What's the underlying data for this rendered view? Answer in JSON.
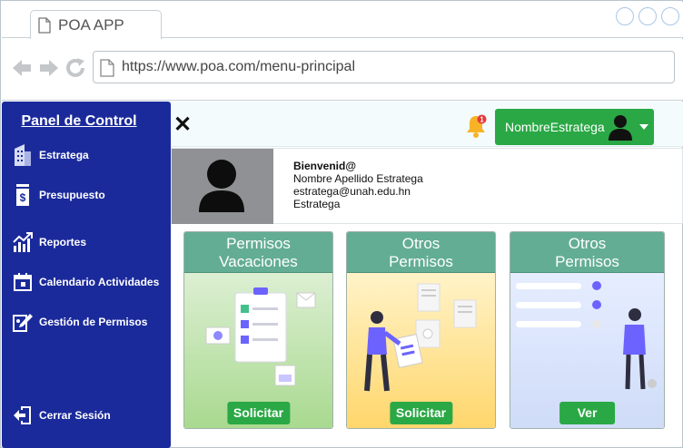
{
  "browser": {
    "tab_title": "POA APP",
    "url": "https://www.poa.com/menu-principal"
  },
  "sidebar": {
    "title": "Panel de Control",
    "items": [
      {
        "label": "Estratega",
        "icon": "building-icon"
      },
      {
        "label": "Presupuesto",
        "icon": "budget-icon"
      },
      {
        "label": "Reportes",
        "icon": "chart-icon"
      },
      {
        "label": "Calendario Actividades",
        "icon": "calendar-icon"
      },
      {
        "label": "Gestión de Permisos",
        "icon": "permissions-icon"
      }
    ],
    "logout": {
      "label": "Cerrar Sesión",
      "icon": "logout-icon"
    }
  },
  "topbar": {
    "user_name": "NombreEstratega",
    "notification_count": "1"
  },
  "profile": {
    "greeting": "Bienvenid@",
    "full_name": "Nombre Apellido Estratega",
    "email": "estratega@unah.edu.hn",
    "role": "Estratega"
  },
  "cards": [
    {
      "title_line1": "Permisos",
      "title_line2": "Vacaciones",
      "button": "Solicitar"
    },
    {
      "title_line1": "Otros",
      "title_line2": "Permisos",
      "button": "Solicitar"
    },
    {
      "title_line1": "Otros",
      "title_line2": "Permisos",
      "button": "Ver"
    }
  ],
  "colors": {
    "sidebar": "#1b2a9b",
    "button_green": "#2aa845",
    "card_header": "#63ad94"
  }
}
